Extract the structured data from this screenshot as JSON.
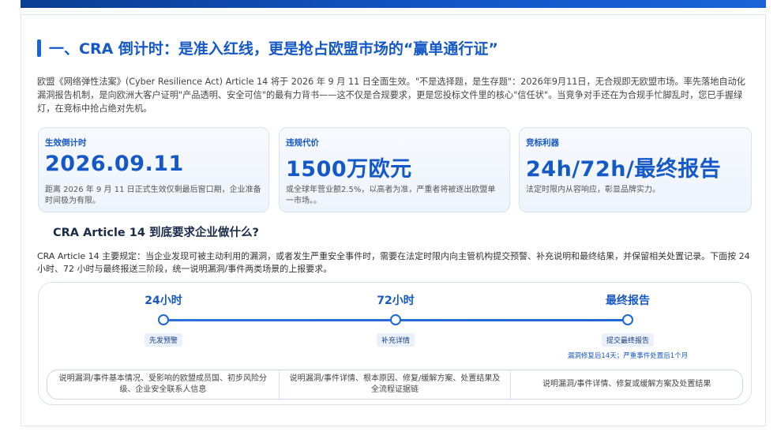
{
  "section": {
    "title": "一、CRA 倒计时：是准入红线，更是抢占欧盟市场的“赢单通行证”",
    "intro": "欧盟《网络弹性法案》(Cyber Resilience Act) Article 14 将于 2026 年 9 月 11 日全面生效。\"不是选择题，是生存题\"：2026年9月11日，无合规即无欧盟市场。率先落地自动化漏洞报告机制，是向欧洲大客户证明\"产品透明、安全可信\"的最有力背书——这不仅是合规要求，更是您投标文件里的核心\"信任状\"。当竞争对手还在为合规手忙脚乱时，您已手握绿灯，在竞标中抢占绝对先机。"
  },
  "stats": [
    {
      "label": "生效倒计时",
      "value": "2026.09.11",
      "desc": "距离 2026 年 9 月 11 日正式生效仅剩最后窗口期，企业准备时间极为有限。"
    },
    {
      "label": "违规代价",
      "value": "1500万欧元",
      "desc": "或全球年营业额2.5%，以高者为准，严重者将被逐出欧盟单一市场。。"
    },
    {
      "label": "竞标利器",
      "value": "24h/72h/最终报告",
      "desc": "法定时限内从容响应，彰显品牌实力。"
    }
  ],
  "requirements": {
    "heading": "CRA Article 14 到底要求企业做什么?",
    "desc": "CRA Article 14 主要规定：当企业发现可被主动利用的漏洞，或者发生严重安全事件时，需要在法定时限内向主管机构提交预警、补充说明和最终结果，并保留相关处置记录。下面按 24 小时、72 小时与最终报送三阶段，统一说明漏洞/事件两类场景的上报要求。"
  },
  "timeline": {
    "phases": [
      {
        "title": "24小时",
        "tag": "先发预警",
        "note": "",
        "detail": "说明漏洞/事件基本情况、受影响的欧盟成员国、初步风险分级、企业安全联系人信息"
      },
      {
        "title": "72小时",
        "tag": "补充详情",
        "note": "",
        "detail": "说明漏洞/事件详情、根本原因、修复/缓解方案、处置结果及全流程证据链"
      },
      {
        "title": "最终报告",
        "tag": "提交最终报告",
        "note": "漏洞修复后14天；严重事件处置后1个月",
        "detail": "说明漏洞/事件详情、修复或缓解方案及处置结果"
      }
    ]
  },
  "colors": {
    "accent": "#1558c7",
    "topbar": "#0b3d91"
  }
}
